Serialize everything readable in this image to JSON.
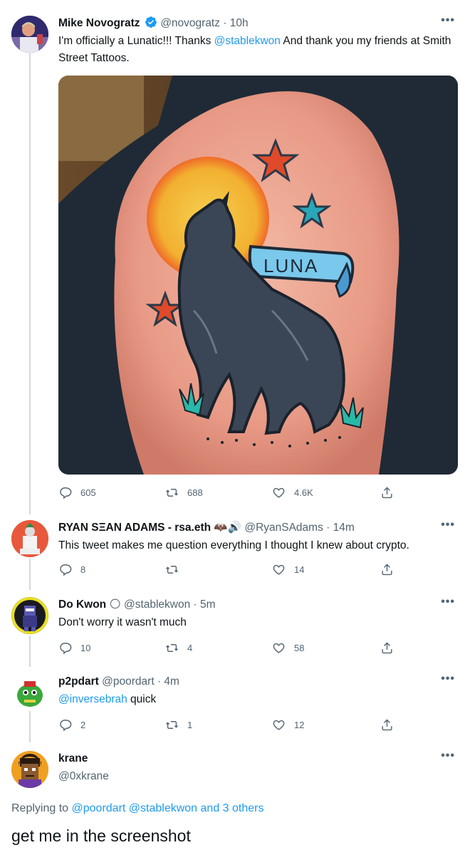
{
  "tweets": [
    {
      "name": "Mike Novogratz",
      "handle": "@novogratz",
      "time": "· 10h",
      "text_prefix": "I'm officially a Lunatic!!!  Thanks ",
      "mention": "@stablekwon",
      "text_suffix": "   And thank you my friends at Smith Street Tattoos.",
      "replies": "605",
      "retweets": "688",
      "likes": "4.6K",
      "image_text": "LUNA"
    },
    {
      "name": "RYAN SΞAN ADAMS - rsa.eth",
      "name_emoji": "🦇🔊",
      "handle": "@RyanSAdams",
      "time": "· 14m",
      "text": "This tweet makes me question everything I thought I knew about crypto.",
      "replies": "8",
      "retweets": "",
      "likes": "14"
    },
    {
      "name": "Do Kwon",
      "name_emoji": "🌕",
      "handle": "@stablekwon",
      "time": "· 5m",
      "text": "Don't worry it wasn't much",
      "replies": "10",
      "retweets": "4",
      "likes": "58"
    },
    {
      "name": "p2pdart",
      "handle": "@poordart",
      "time": "· 4m",
      "mention": "@inversebrah",
      "text_suffix": " quick",
      "replies": "2",
      "retweets": "1",
      "likes": "12"
    },
    {
      "name": "krane",
      "handle": "@0xkrane"
    }
  ],
  "reply": {
    "replying_to_label": "Replying to ",
    "replying_to_targets": "@poordart @stablekwon and 3 others",
    "text": "get me in the screenshot"
  },
  "more_label": "•••",
  "colors": {
    "link": "#1d9bf0",
    "muted": "#536471",
    "verified": "#1d9bf0",
    "thread_line": "#cfd9de"
  }
}
